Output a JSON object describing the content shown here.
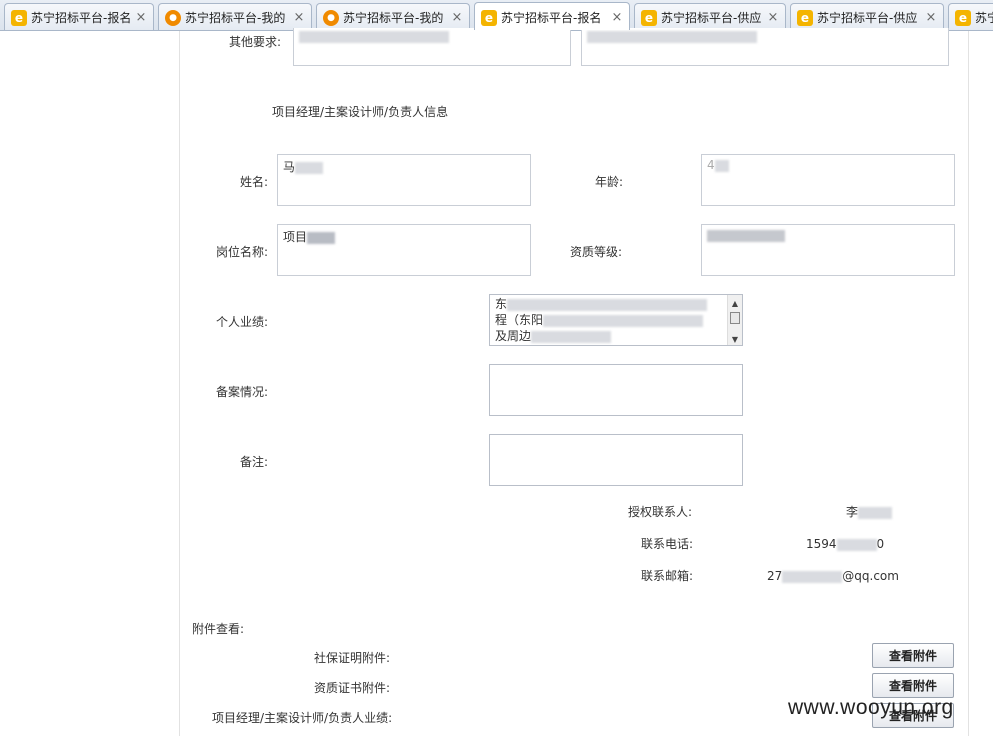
{
  "tabs": [
    {
      "title": "苏宁招标平台-报名",
      "icon": "ie-icon",
      "active": false
    },
    {
      "title": "苏宁招标平台-我的",
      "icon": "tiger-icon",
      "active": false
    },
    {
      "title": "苏宁招标平台-我的",
      "icon": "tiger-icon",
      "active": false
    },
    {
      "title": "苏宁招标平台-报名",
      "icon": "ie-icon",
      "active": true
    },
    {
      "title": "苏宁招标平台-供应",
      "icon": "ie-icon",
      "active": false
    },
    {
      "title": "苏宁招标平台-供应",
      "icon": "ie-icon",
      "active": false
    },
    {
      "title": "苏宁",
      "icon": "ie-icon",
      "active": false
    }
  ],
  "tab_close_glyph": "×",
  "form": {
    "other_requirements_label": "其他要求:",
    "section_title": "项目经理/主案设计师/负责人信息",
    "name_label": "姓名:",
    "name_value": "马",
    "age_label": "年龄:",
    "age_value": "4",
    "position_label": "岗位名称:",
    "position_value": "项目",
    "qualification_label": "资质等级:",
    "performance_label": "个人业绩:",
    "performance_lines": [
      "东",
      "程（东阳",
      "及周边"
    ],
    "filing_label": "备案情况:",
    "remarks_label": "备注:"
  },
  "contact": {
    "auth_contact_label": "授权联系人:",
    "auth_contact_value": "李",
    "phone_label": "联系电话:",
    "phone_prefix": "1594",
    "phone_suffix": "0",
    "email_label": "联系邮箱:",
    "email_prefix": "27",
    "email_suffix": "@qq.com"
  },
  "attachments": {
    "heading": "附件查看:",
    "items": [
      {
        "label": "社保证明附件:",
        "button": "查看附件"
      },
      {
        "label": "资质证书附件:",
        "button": "查看附件"
      },
      {
        "label": "项目经理/主案设计师/负责人业绩:",
        "button": "查看附件"
      }
    ]
  },
  "watermark": "www.wooyun.org"
}
